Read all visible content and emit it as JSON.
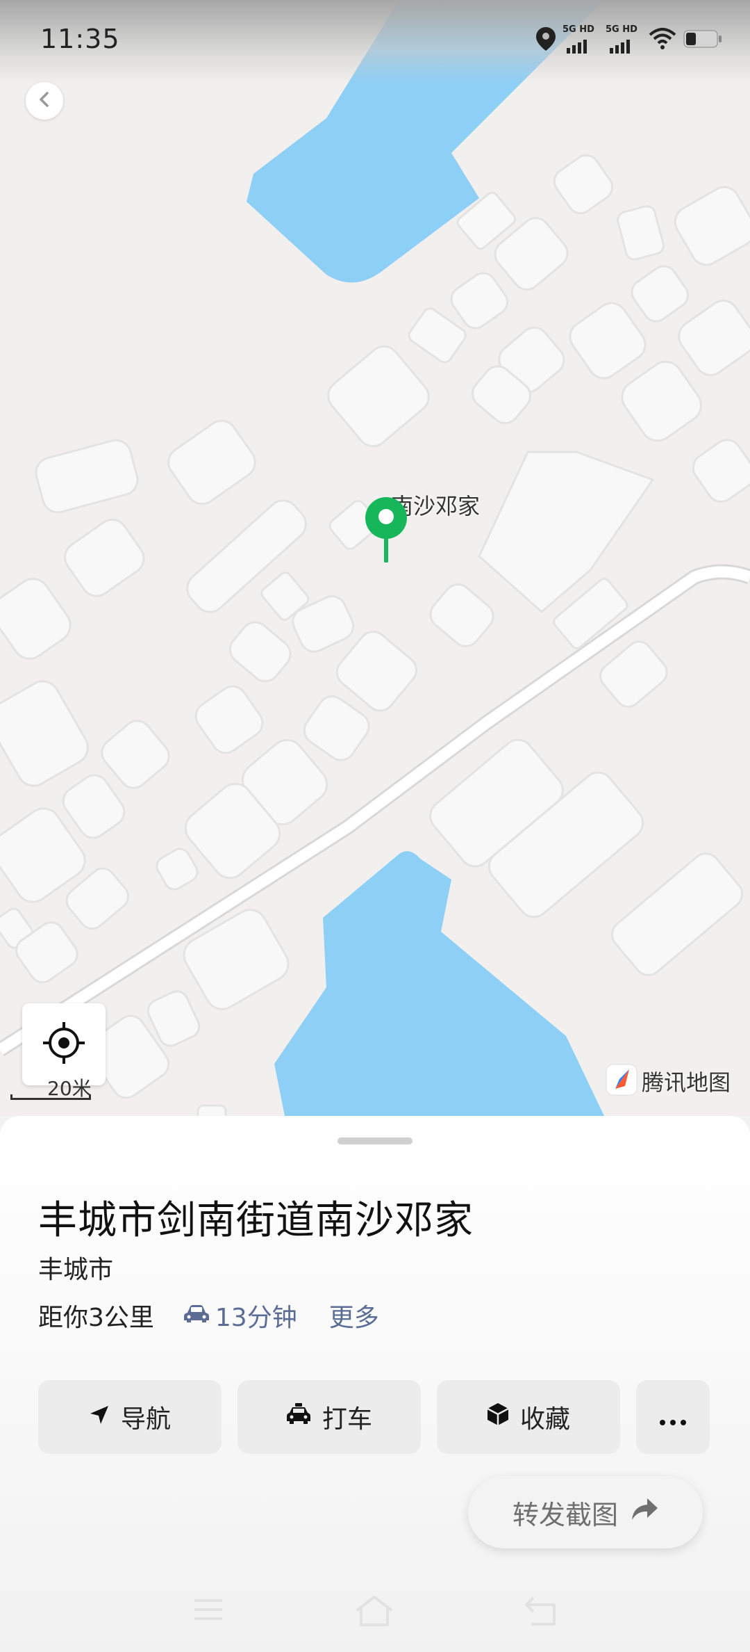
{
  "status_bar": {
    "time": "11:35",
    "network_1": "5G HD",
    "network_2": "5G HD",
    "icons": [
      "location-icon",
      "signal-5g-icon",
      "signal-5g-icon",
      "wifi-icon",
      "battery-icon"
    ]
  },
  "map": {
    "poi_label": "南沙邓家",
    "scale_label": "20米",
    "brand": "腾讯地图",
    "colors": {
      "water": "#8ecff5",
      "building": "#f8f8f9",
      "ground": "#f1f0ee",
      "pin": "#17b65a"
    }
  },
  "sheet": {
    "title": "丰城市剑南街道南沙邓家",
    "city": "丰城市",
    "distance": "距你3公里",
    "drive_time": "13分钟",
    "more": "更多",
    "actions": {
      "navigate": "导航",
      "taxi": "打车",
      "favorite": "收藏"
    },
    "share": "转发截图"
  }
}
